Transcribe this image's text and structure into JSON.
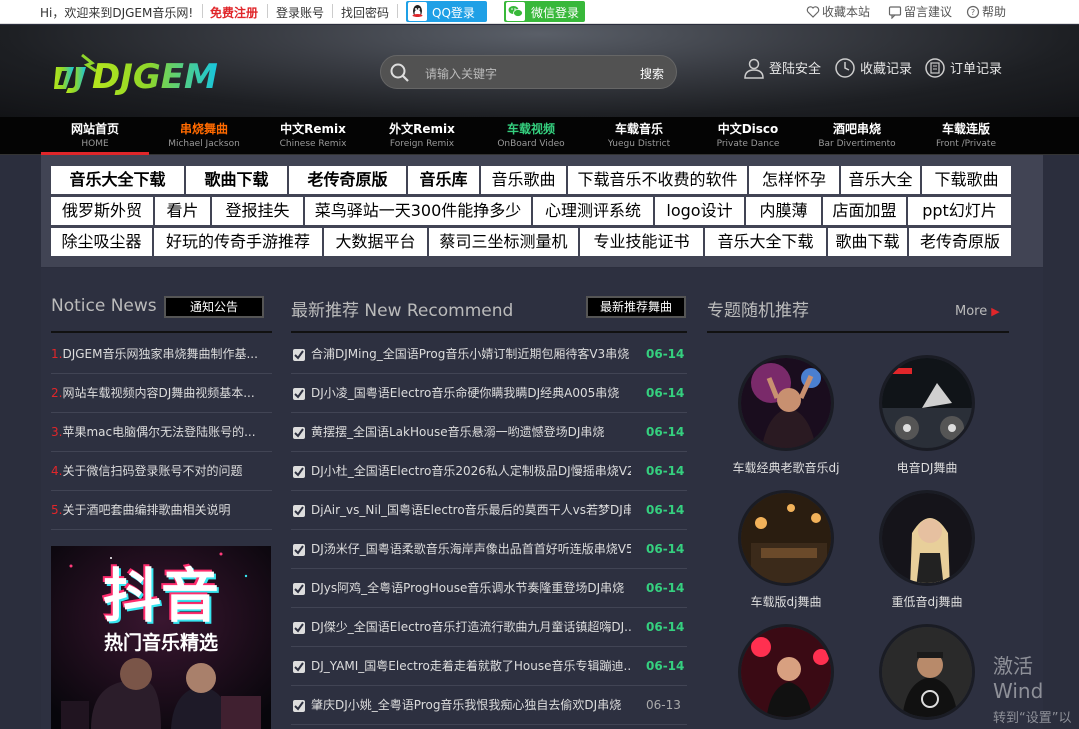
{
  "topbar": {
    "greeting": "Hi，欢迎来到DJGEM音乐网!",
    "register": "免费注册",
    "login": "登录账号",
    "recover": "找回密码",
    "qq_login": "QQ登录",
    "wechat_login": "微信登录",
    "bookmark": "收藏本站",
    "feedback": "留言建议",
    "help": "帮助"
  },
  "header": {
    "logo_text": "DJGEM",
    "search_placeholder": "请输入关键字",
    "search_button": "搜索",
    "login_security": "登陆安全",
    "favorites": "收藏记录",
    "orders": "订单记录"
  },
  "nav": [
    {
      "zh": "网站首页",
      "en": "HOME"
    },
    {
      "zh": "串烧舞曲",
      "en": "Michael Jackson"
    },
    {
      "zh": "中文Remix",
      "en": "Chinese Remix"
    },
    {
      "zh": "外文Remix",
      "en": "Foreign Remix"
    },
    {
      "zh": "车载视频",
      "en": "OnBoard Video"
    },
    {
      "zh": "车载音乐",
      "en": "Yuegu District"
    },
    {
      "zh": "中文Disco",
      "en": "Private Dance"
    },
    {
      "zh": "酒吧串烧",
      "en": "Bar Divertimento"
    },
    {
      "zh": "车载连版",
      "en": "Front /Private"
    }
  ],
  "tags": [
    "音乐大全下载",
    "歌曲下载",
    "老传奇原版",
    "音乐库",
    "音乐歌曲",
    "下载音乐不收费的软件",
    "怎样怀孕",
    "音乐大全",
    "下载歌曲",
    "俄罗斯外贸",
    "看片",
    "登报挂失",
    "菜鸟驿站一天300件能挣多少",
    "心理测评系统",
    "logo设计",
    "内膜薄",
    "店面加盟",
    "ppt幻灯片",
    "除尘吸尘器",
    "好玩的传奇手游推荐",
    "大数据平台",
    "蔡司三坐标测量机",
    "专业技能证书",
    "音乐大全下载",
    "歌曲下载",
    "老传奇原版"
  ],
  "notice": {
    "title": "Notice News",
    "label": "通知公告",
    "items": [
      {
        "num": "1.",
        "text": "DJGEM音乐网独家串烧舞曲制作基..."
      },
      {
        "num": "2.",
        "text": "网站车载视频内容DJ舞曲视频基本..."
      },
      {
        "num": "3.",
        "text": "苹果mac电脑偶尔无法登陆账号的..."
      },
      {
        "num": "4.",
        "text": "关于微信扫码登录账号不对的问题"
      },
      {
        "num": "5.",
        "text": "关于酒吧套曲编排歌曲相关说明"
      }
    ],
    "promo_big": "抖音",
    "promo_sub": "热门音乐精选"
  },
  "recommend": {
    "title": "最新推荐 New Recommend",
    "label": "最新推荐舞曲",
    "items": [
      {
        "text": "合浦DJMing_全国语Prog音乐小婧订制近期包厢待客V3串烧",
        "date": "06-14"
      },
      {
        "text": "DJ小凌_国粤语Electro音乐命硬你瞒我瞒DJ经典A005串烧",
        "date": "06-14"
      },
      {
        "text": "黄摆摆_全国语LakHouse音乐悬溺一哟遗憾登场DJ串烧",
        "date": "06-14"
      },
      {
        "text": "DJ小杜_全国语Electro音乐2026私人定制极品DJ慢摇串烧V2",
        "date": "06-14"
      },
      {
        "text": "DjAir_vs_Nil_国粤语Electro音乐最后的莫西干人vs若梦DJ串烧",
        "date": "06-14"
      },
      {
        "text": "DJ汤米仔_国粤语柔歌音乐海岸声像出品首首好听连版串烧V5",
        "date": "06-14"
      },
      {
        "text": "DJys阿鸡_全粤语ProgHouse音乐调水节奏隆重登场DJ串烧",
        "date": "06-14"
      },
      {
        "text": "DJ傑少_全国语Electro音乐打造流行歌曲九月童话镇超嗨DJ...",
        "date": "06-14"
      },
      {
        "text": "DJ_YAMI_国粤Electro走着走着就散了House音乐专辑蹦迪...",
        "date": "06-14"
      },
      {
        "text": "肇庆DJ小姚_全粤语Prog音乐我恨我痴心独自去偷欢DJ串烧",
        "date": "06-13"
      }
    ]
  },
  "topics": {
    "title": "专题随机推荐",
    "more": "More",
    "items": [
      {
        "label": "车载经典老歌音乐dj"
      },
      {
        "label": "电音DJ舞曲"
      },
      {
        "label": "车载版dj舞曲"
      },
      {
        "label": "重低音dj舞曲"
      },
      {
        "label": ""
      },
      {
        "label": ""
      }
    ]
  },
  "watermark": {
    "line1": "激活 Wind",
    "line2": "转到“设置”以"
  }
}
